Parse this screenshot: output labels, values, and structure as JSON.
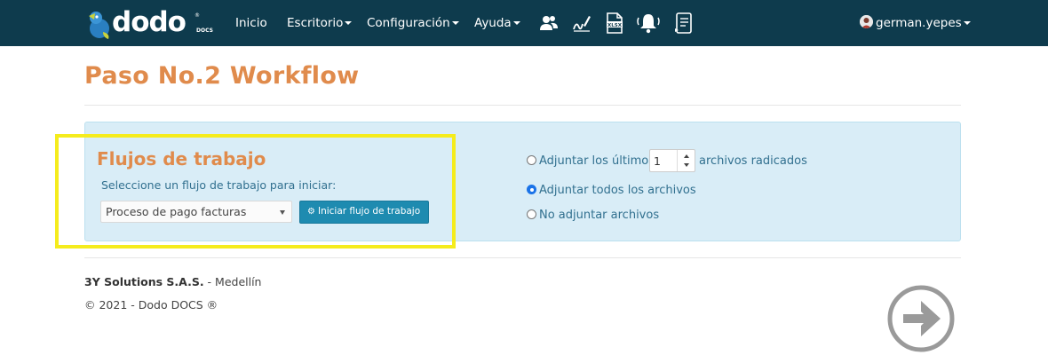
{
  "navbar": {
    "logo_text": "dodo",
    "logo_sub": "DOCS",
    "logo_reg": "®",
    "items": [
      {
        "label": "Inicio"
      },
      {
        "label": "Escritorio"
      },
      {
        "label": "Configuración"
      },
      {
        "label": "Ayuda"
      }
    ],
    "icons": [
      "users-icon",
      "signature-icon",
      "xlsx-file-icon",
      "bell-icon",
      "document-list-icon"
    ],
    "icon_xlsx_label": "XLSX",
    "user": "german.yepes"
  },
  "page": {
    "title": "Paso No.2 Workflow"
  },
  "workflow": {
    "title": "Flujos de trabajo",
    "subtitle": "Seleccione un flujo de trabajo para iniciar:",
    "select_value": "Proceso de pago facturas",
    "start_button": "Iniciar flujo de trabajo"
  },
  "attach_options": {
    "last_label_before": "Adjuntar los últimos",
    "last_count": "1",
    "last_label_after": "archivos radicados",
    "all_label": "Adjuntar todos los archivos",
    "none_label": "No adjuntar archivos",
    "selected": "all"
  },
  "footer": {
    "company": "3Y Solutions S.A.S.",
    "city": " - Medellín",
    "copyright": "© 2021 - Dodo DOCS ®"
  },
  "colors": {
    "navbar": "#0e3b4d",
    "accent_orange": "#e08b4c",
    "panel": "#d9edf7",
    "button": "#1e8bb0",
    "highlight": "#f5ec1d"
  }
}
